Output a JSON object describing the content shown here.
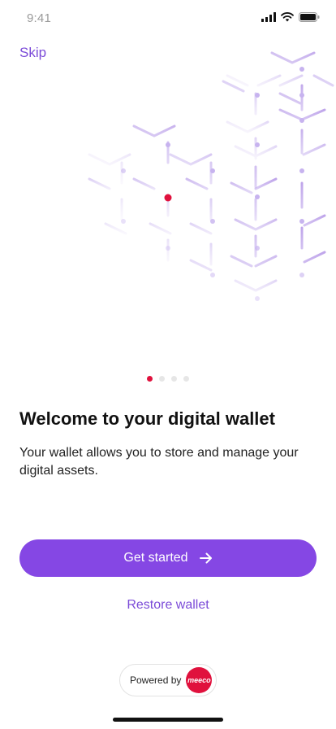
{
  "status": {
    "time": "9:41"
  },
  "header": {
    "skip_label": "Skip"
  },
  "onboarding": {
    "page_count": 4,
    "active_page_index": 0,
    "title": "Welcome to your digital wallet",
    "description": "Your wallet allows you to store and manage your digital assets."
  },
  "actions": {
    "primary_label": "Get started",
    "secondary_label": "Restore wallet"
  },
  "footer": {
    "powered_by_label": "Powered by",
    "brand_logo_text": "meeco"
  },
  "colors": {
    "accent": "#8547e4",
    "accent_text": "#7b4bd8",
    "brand_red": "#e0113d",
    "pattern": "#c7b3ef"
  },
  "icons": [
    "cellular-signal-icon",
    "wifi-icon",
    "battery-icon",
    "arrow-right-icon",
    "meeco-logo"
  ]
}
